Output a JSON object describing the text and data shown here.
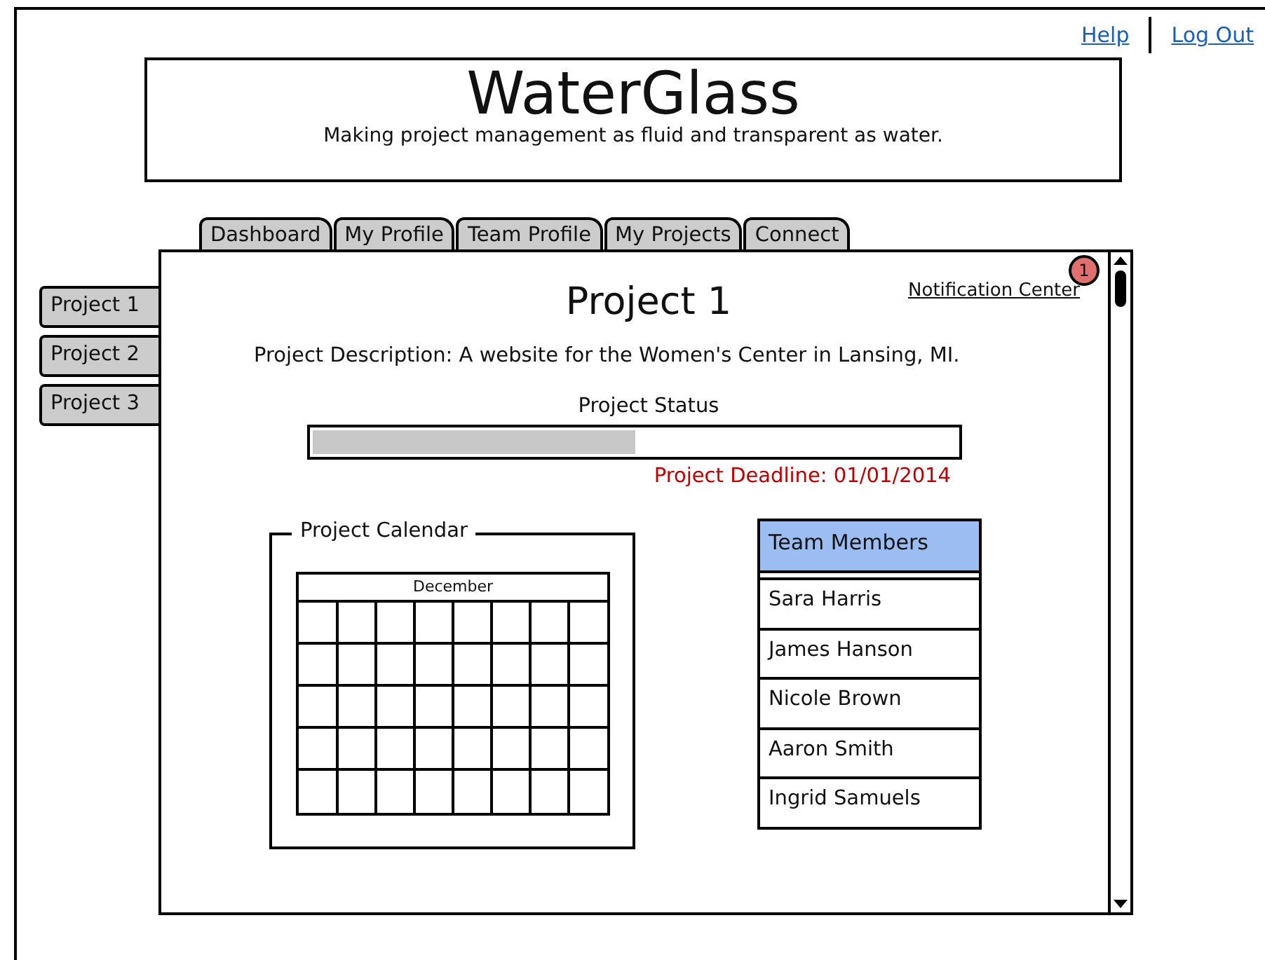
{
  "links": [
    {
      "label": "Help"
    },
    {
      "label": "Log Out"
    }
  ],
  "header": {
    "title": "WaterGlass",
    "tagline": "Making project management as fluid and transparent as water."
  },
  "tabs": [
    {
      "label": "Dashboard",
      "selected": false
    },
    {
      "label": "My Profile",
      "selected": false
    },
    {
      "label": "Team Profile",
      "selected": false
    },
    {
      "label": "My Projects",
      "selected": false
    },
    {
      "label": "Connect",
      "selected": false
    }
  ],
  "projects": [
    {
      "label": "Project 1",
      "selected": false
    },
    {
      "label": "Project 2",
      "selected": false
    },
    {
      "label": "Project 3",
      "selected": false
    }
  ],
  "notification": {
    "label": "Notification Center",
    "count": "1"
  },
  "project": {
    "title": "Project 1",
    "description": "Project Description: A website for the Women's Center in Lansing, MI.",
    "status_label": "Project Status",
    "level": 0.5,
    "deadline": "Project Deadline: 01/01/2014"
  },
  "calendar": {
    "title": "Project Calendar",
    "month": "December"
  },
  "team": {
    "header": "Team Members",
    "members": [
      "Sara Harris",
      "James Hanson",
      "Nicole Brown",
      "Aaron Smith",
      "Ingrid Samuels"
    ]
  }
}
